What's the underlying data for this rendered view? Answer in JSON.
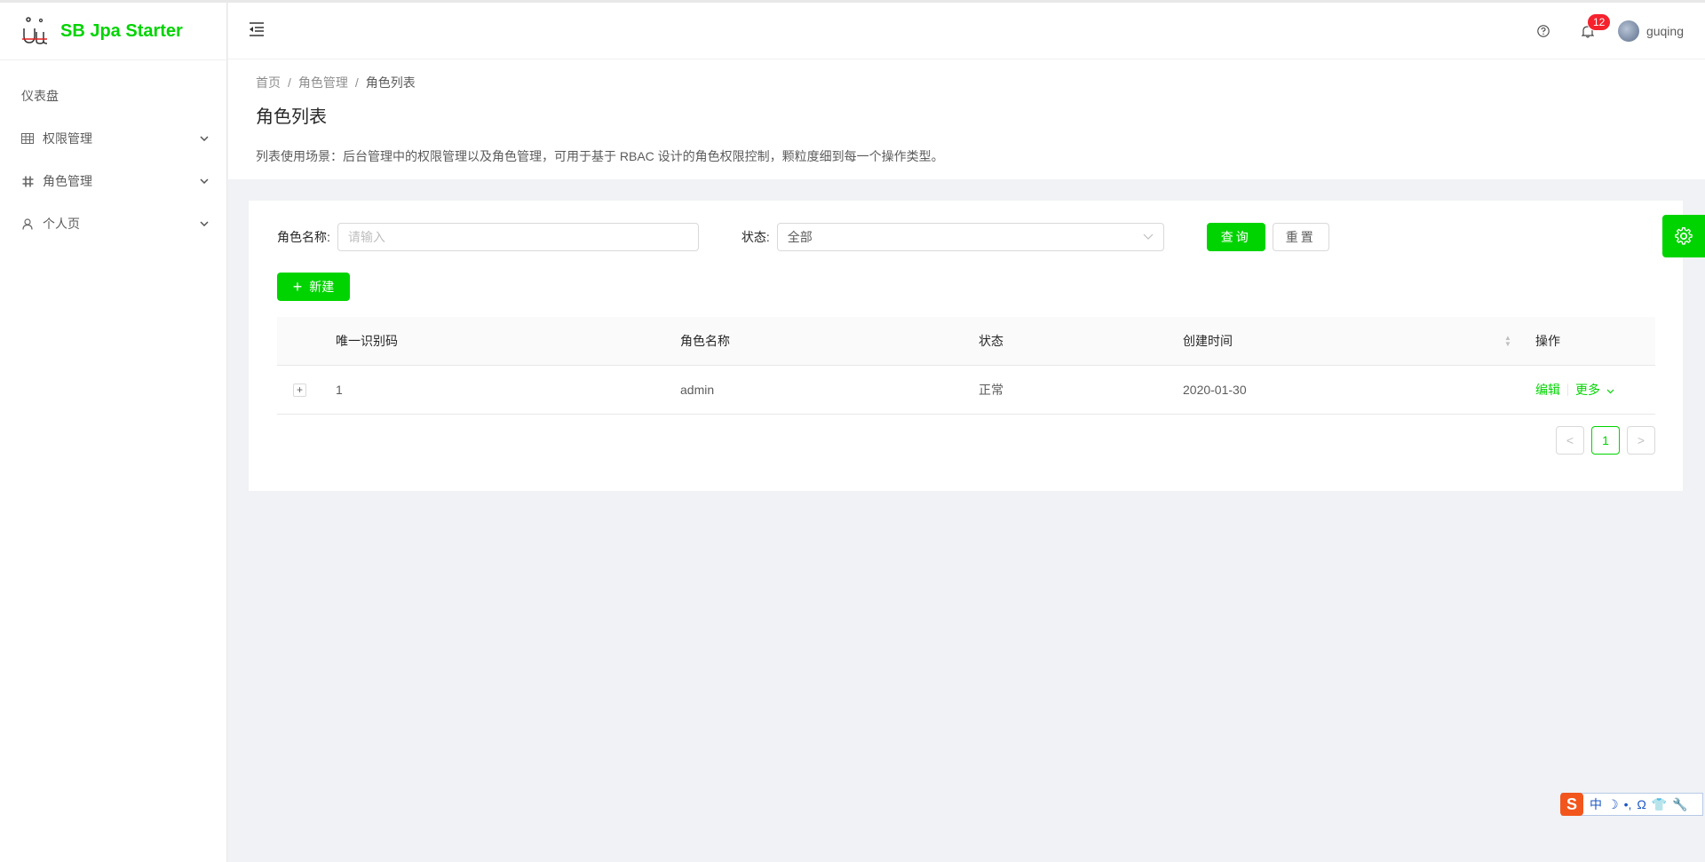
{
  "app": {
    "title": "SB Jpa Starter"
  },
  "colors": {
    "primary": "#00d400",
    "badge": "#f5222d"
  },
  "sidebar": {
    "items": [
      {
        "label": "仪表盘",
        "icon": "",
        "has_submenu": false
      },
      {
        "label": "权限管理",
        "icon": "table-icon",
        "has_submenu": true
      },
      {
        "label": "角色管理",
        "icon": "slack-icon",
        "has_submenu": true
      },
      {
        "label": "个人页",
        "icon": "user-icon",
        "has_submenu": true
      }
    ]
  },
  "header": {
    "notification_count": "12",
    "username": "guqing"
  },
  "breadcrumb": {
    "home": "首页",
    "parent": "角色管理",
    "current": "角色列表",
    "separator": "/"
  },
  "page": {
    "title": "角色列表",
    "description": "列表使用场景：后台管理中的权限管理以及角色管理，可用于基于 RBAC 设计的角色权限控制，颗粒度细到每一个操作类型。"
  },
  "filter": {
    "role_name_label": "角色名称:",
    "role_name_placeholder": "请输入",
    "status_label": "状态:",
    "status_value": "全部",
    "query_label": "查询",
    "reset_label": "重置"
  },
  "toolbar": {
    "new_label": "新建"
  },
  "table": {
    "columns": [
      "唯一识别码",
      "角色名称",
      "状态",
      "创建时间",
      "操作"
    ],
    "rows": [
      {
        "id": "1",
        "name": "admin",
        "status": "正常",
        "created": "2020-01-30",
        "edit": "编辑",
        "more": "更多"
      }
    ]
  },
  "pagination": {
    "prev": "<",
    "current": "1",
    "next": ">"
  },
  "ime": {
    "logo": "S",
    "mode": "中"
  }
}
